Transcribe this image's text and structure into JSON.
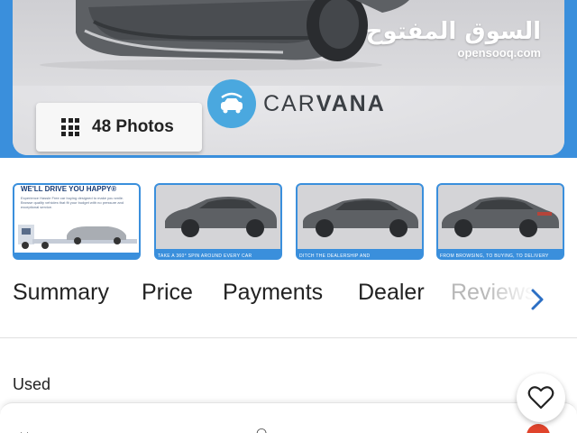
{
  "watermark": {
    "arabic": "السوق المفتوح",
    "latin": "opensooq.com"
  },
  "hero": {
    "brand": "CARVANA",
    "brand_light": "CAR",
    "brand_bold": "VANA",
    "photos_button": "48 Photos"
  },
  "thumbnails": [
    {
      "type": "ad",
      "title": "WE'LL DRIVE YOU HAPPY®",
      "text": "Experience Hassle Free car buying designed to make you smile. Browse quality vehicles that fit your budget with no pressure and exceptional service."
    },
    {
      "type": "photo",
      "caption": "TAKE A 360° SPIN AROUND EVERY CAR"
    },
    {
      "type": "photo",
      "caption": "DITCH THE DEALERSHIP AND"
    },
    {
      "type": "photo",
      "caption": "FROM BROWSING, TO BUYING, TO DELIVERY"
    }
  ],
  "tabs": [
    {
      "label": "Summary"
    },
    {
      "label": "Price"
    },
    {
      "label": "Payments"
    },
    {
      "label": "Dealer"
    },
    {
      "label": "Reviews"
    }
  ],
  "listing": {
    "condition": "Used"
  },
  "icons": {
    "grid": "grid-icon",
    "chevron": "chevron-right-icon",
    "favorite": "heart-icon",
    "brand": "car-badge-icon"
  },
  "colors": {
    "accent_blue": "#3a8fdc",
    "carvana_blue": "#4aa8df",
    "car_gray": "#5d6064",
    "red": "#e0442c"
  }
}
